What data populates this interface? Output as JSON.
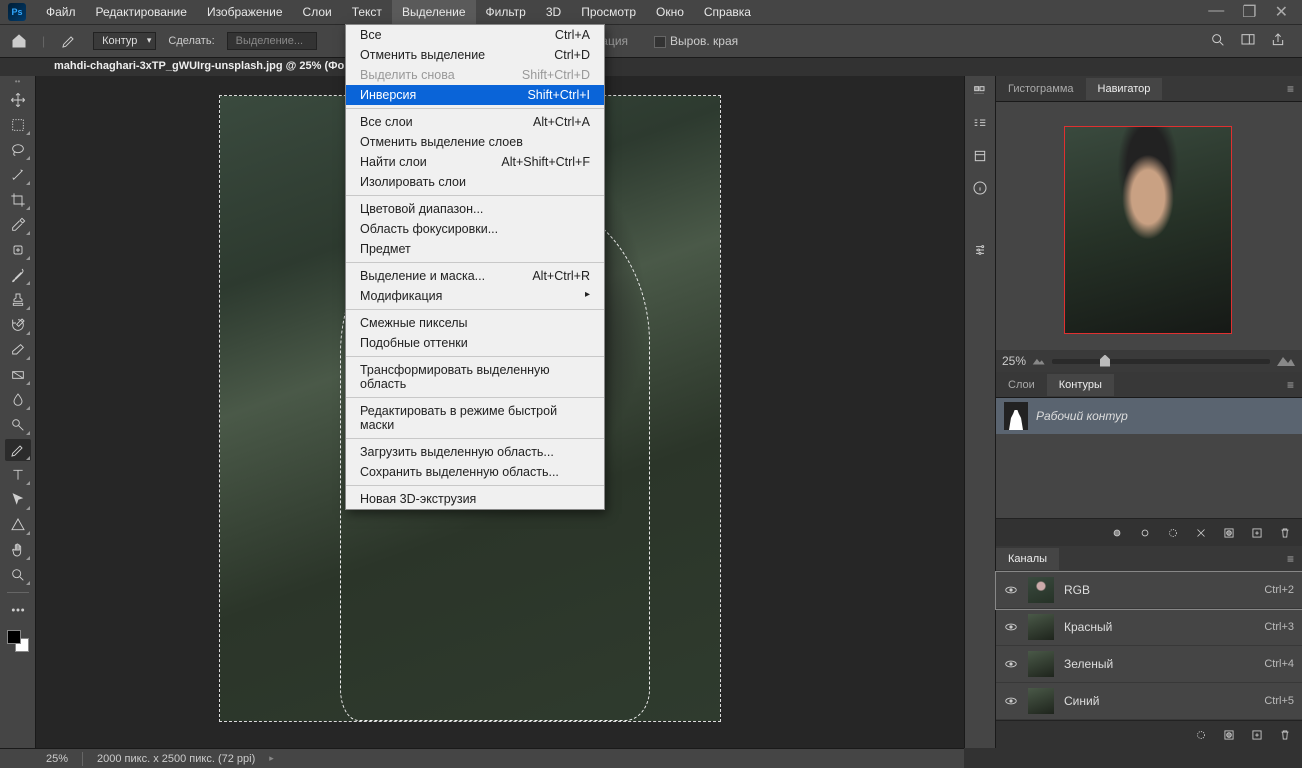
{
  "app": {
    "logo": "Ps"
  },
  "menu": {
    "items": [
      "Файл",
      "Редактирование",
      "Изображение",
      "Слои",
      "Текст",
      "Выделение",
      "Фильтр",
      "3D",
      "Просмотр",
      "Окно",
      "Справка"
    ],
    "openIndex": 5
  },
  "dropdown": {
    "groups": [
      [
        {
          "label": "Все",
          "shortcut": "Ctrl+A"
        },
        {
          "label": "Отменить выделение",
          "shortcut": "Ctrl+D"
        },
        {
          "label": "Выделить снова",
          "shortcut": "Shift+Ctrl+D",
          "disabled": true
        },
        {
          "label": "Инверсия",
          "shortcut": "Shift+Ctrl+I",
          "highlight": true
        }
      ],
      [
        {
          "label": "Все слои",
          "shortcut": "Alt+Ctrl+A"
        },
        {
          "label": "Отменить выделение слоев",
          "shortcut": ""
        },
        {
          "label": "Найти слои",
          "shortcut": "Alt+Shift+Ctrl+F"
        },
        {
          "label": "Изолировать слои",
          "shortcut": ""
        }
      ],
      [
        {
          "label": "Цветовой диапазон...",
          "shortcut": ""
        },
        {
          "label": "Область фокусировки...",
          "shortcut": ""
        },
        {
          "label": "Предмет",
          "shortcut": ""
        }
      ],
      [
        {
          "label": "Выделение и маска...",
          "shortcut": "Alt+Ctrl+R"
        },
        {
          "label": "Модификация",
          "shortcut": "",
          "submenu": true
        }
      ],
      [
        {
          "label": "Смежные пикселы",
          "shortcut": ""
        },
        {
          "label": "Подобные оттенки",
          "shortcut": ""
        }
      ],
      [
        {
          "label": "Трансформировать выделенную область",
          "shortcut": ""
        }
      ],
      [
        {
          "label": "Редактировать в режиме быстрой маски",
          "shortcut": ""
        }
      ],
      [
        {
          "label": "Загрузить выделенную область...",
          "shortcut": ""
        },
        {
          "label": "Сохранить выделенную область...",
          "shortcut": ""
        }
      ],
      [
        {
          "label": "Новая 3D-экструзия",
          "shortcut": ""
        }
      ]
    ]
  },
  "optionsbar": {
    "pathMode": "Контур",
    "makeLabel": "Сделать:",
    "selectionBtn": "Выделение...",
    "optimization": "тимизация",
    "edgeTrim": "Выров. края"
  },
  "document": {
    "tab": "mahdi-chaghari-3xTP_gWUIrg-unsplash.jpg @ 25% (Фо"
  },
  "panels": {
    "histTab": "Гистограмма",
    "navTab": "Навигатор",
    "zoom": "25%",
    "layersTab": "Слои",
    "pathsTab": "Контуры",
    "pathItem": "Рабочий контур",
    "channelsTab": "Каналы",
    "channels": [
      {
        "name": "RGB",
        "short": "Ctrl+2"
      },
      {
        "name": "Красный",
        "short": "Ctrl+3"
      },
      {
        "name": "Зеленый",
        "short": "Ctrl+4"
      },
      {
        "name": "Синий",
        "short": "Ctrl+5"
      }
    ]
  },
  "status": {
    "zoom": "25%",
    "dims": "2000 пикс. x 2500 пикс. (72 ppi)"
  }
}
